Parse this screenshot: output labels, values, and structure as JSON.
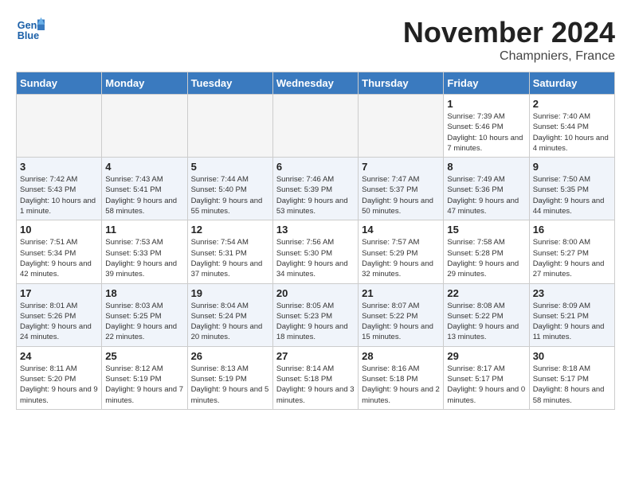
{
  "logo": {
    "line1": "General",
    "line2": "Blue"
  },
  "title": "November 2024",
  "location": "Champniers, France",
  "days_of_week": [
    "Sunday",
    "Monday",
    "Tuesday",
    "Wednesday",
    "Thursday",
    "Friday",
    "Saturday"
  ],
  "weeks": [
    [
      {
        "day": "",
        "info": ""
      },
      {
        "day": "",
        "info": ""
      },
      {
        "day": "",
        "info": ""
      },
      {
        "day": "",
        "info": ""
      },
      {
        "day": "",
        "info": ""
      },
      {
        "day": "1",
        "info": "Sunrise: 7:39 AM\nSunset: 5:46 PM\nDaylight: 10 hours and 7 minutes."
      },
      {
        "day": "2",
        "info": "Sunrise: 7:40 AM\nSunset: 5:44 PM\nDaylight: 10 hours and 4 minutes."
      }
    ],
    [
      {
        "day": "3",
        "info": "Sunrise: 7:42 AM\nSunset: 5:43 PM\nDaylight: 10 hours and 1 minute."
      },
      {
        "day": "4",
        "info": "Sunrise: 7:43 AM\nSunset: 5:41 PM\nDaylight: 9 hours and 58 minutes."
      },
      {
        "day": "5",
        "info": "Sunrise: 7:44 AM\nSunset: 5:40 PM\nDaylight: 9 hours and 55 minutes."
      },
      {
        "day": "6",
        "info": "Sunrise: 7:46 AM\nSunset: 5:39 PM\nDaylight: 9 hours and 53 minutes."
      },
      {
        "day": "7",
        "info": "Sunrise: 7:47 AM\nSunset: 5:37 PM\nDaylight: 9 hours and 50 minutes."
      },
      {
        "day": "8",
        "info": "Sunrise: 7:49 AM\nSunset: 5:36 PM\nDaylight: 9 hours and 47 minutes."
      },
      {
        "day": "9",
        "info": "Sunrise: 7:50 AM\nSunset: 5:35 PM\nDaylight: 9 hours and 44 minutes."
      }
    ],
    [
      {
        "day": "10",
        "info": "Sunrise: 7:51 AM\nSunset: 5:34 PM\nDaylight: 9 hours and 42 minutes."
      },
      {
        "day": "11",
        "info": "Sunrise: 7:53 AM\nSunset: 5:33 PM\nDaylight: 9 hours and 39 minutes."
      },
      {
        "day": "12",
        "info": "Sunrise: 7:54 AM\nSunset: 5:31 PM\nDaylight: 9 hours and 37 minutes."
      },
      {
        "day": "13",
        "info": "Sunrise: 7:56 AM\nSunset: 5:30 PM\nDaylight: 9 hours and 34 minutes."
      },
      {
        "day": "14",
        "info": "Sunrise: 7:57 AM\nSunset: 5:29 PM\nDaylight: 9 hours and 32 minutes."
      },
      {
        "day": "15",
        "info": "Sunrise: 7:58 AM\nSunset: 5:28 PM\nDaylight: 9 hours and 29 minutes."
      },
      {
        "day": "16",
        "info": "Sunrise: 8:00 AM\nSunset: 5:27 PM\nDaylight: 9 hours and 27 minutes."
      }
    ],
    [
      {
        "day": "17",
        "info": "Sunrise: 8:01 AM\nSunset: 5:26 PM\nDaylight: 9 hours and 24 minutes."
      },
      {
        "day": "18",
        "info": "Sunrise: 8:03 AM\nSunset: 5:25 PM\nDaylight: 9 hours and 22 minutes."
      },
      {
        "day": "19",
        "info": "Sunrise: 8:04 AM\nSunset: 5:24 PM\nDaylight: 9 hours and 20 minutes."
      },
      {
        "day": "20",
        "info": "Sunrise: 8:05 AM\nSunset: 5:23 PM\nDaylight: 9 hours and 18 minutes."
      },
      {
        "day": "21",
        "info": "Sunrise: 8:07 AM\nSunset: 5:22 PM\nDaylight: 9 hours and 15 minutes."
      },
      {
        "day": "22",
        "info": "Sunrise: 8:08 AM\nSunset: 5:22 PM\nDaylight: 9 hours and 13 minutes."
      },
      {
        "day": "23",
        "info": "Sunrise: 8:09 AM\nSunset: 5:21 PM\nDaylight: 9 hours and 11 minutes."
      }
    ],
    [
      {
        "day": "24",
        "info": "Sunrise: 8:11 AM\nSunset: 5:20 PM\nDaylight: 9 hours and 9 minutes."
      },
      {
        "day": "25",
        "info": "Sunrise: 8:12 AM\nSunset: 5:19 PM\nDaylight: 9 hours and 7 minutes."
      },
      {
        "day": "26",
        "info": "Sunrise: 8:13 AM\nSunset: 5:19 PM\nDaylight: 9 hours and 5 minutes."
      },
      {
        "day": "27",
        "info": "Sunrise: 8:14 AM\nSunset: 5:18 PM\nDaylight: 9 hours and 3 minutes."
      },
      {
        "day": "28",
        "info": "Sunrise: 8:16 AM\nSunset: 5:18 PM\nDaylight: 9 hours and 2 minutes."
      },
      {
        "day": "29",
        "info": "Sunrise: 8:17 AM\nSunset: 5:17 PM\nDaylight: 9 hours and 0 minutes."
      },
      {
        "day": "30",
        "info": "Sunrise: 8:18 AM\nSunset: 5:17 PM\nDaylight: 8 hours and 58 minutes."
      }
    ]
  ]
}
